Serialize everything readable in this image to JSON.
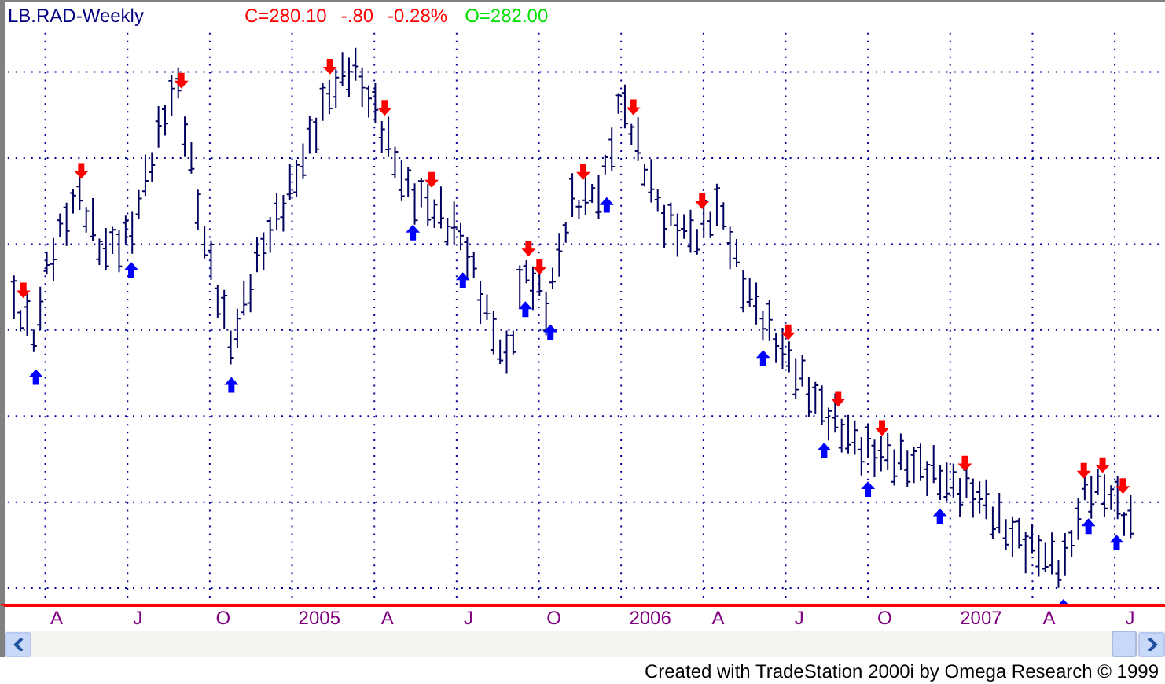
{
  "chart": {
    "title": "LB.RAD-Weekly",
    "close": "C=280.10",
    "change": "-.80",
    "change_percent": "-0.28%",
    "open": "O=282.00"
  },
  "x_axis": {
    "labels": [
      "A",
      "J",
      "O",
      "2005",
      "A",
      "J",
      "O",
      "2006",
      "A",
      "J",
      "O",
      "2007",
      "A",
      "J"
    ]
  },
  "footer": "Created with TradeStation 2000i by Omega Research © 1999"
}
